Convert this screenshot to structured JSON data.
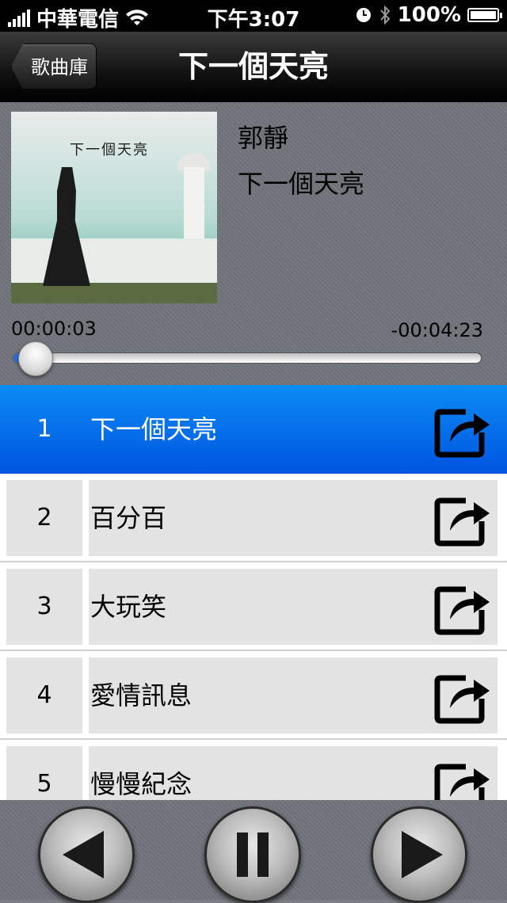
{
  "status_bar": {
    "carrier": "中華電信",
    "time": "下午3:07",
    "battery": "100%"
  },
  "nav": {
    "back_label": "歌曲庫",
    "title": "下一個天亮"
  },
  "now_playing": {
    "artist": "郭靜",
    "album": "下一個天亮",
    "elapsed": "00:00:03",
    "remaining": "-00:04:23",
    "progress_fraction": 0.011,
    "album_art_text": "下一個天亮"
  },
  "tracks": [
    {
      "number": "1",
      "title": "下一個天亮",
      "selected": true
    },
    {
      "number": "2",
      "title": "百分百",
      "selected": false
    },
    {
      "number": "3",
      "title": "大玩笑",
      "selected": false
    },
    {
      "number": "4",
      "title": "愛情訊息",
      "selected": false
    },
    {
      "number": "5",
      "title": "慢慢紀念",
      "selected": false
    }
  ],
  "controls": [
    "previous-icon",
    "pause-icon",
    "next-icon"
  ],
  "colors": {
    "selected_row": "#0a6cf0",
    "nav_bar": "#111111",
    "panel": "#72757b"
  }
}
